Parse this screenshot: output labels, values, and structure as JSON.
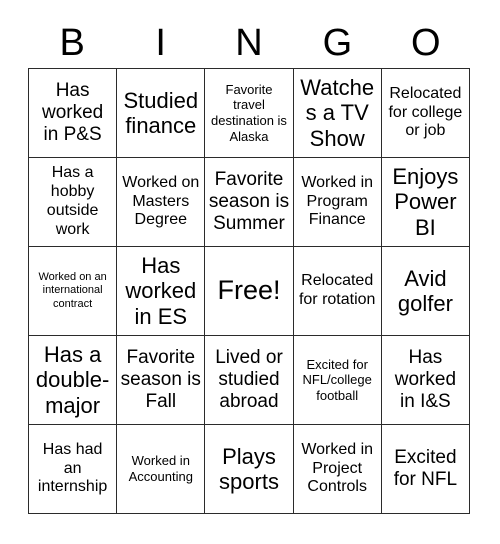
{
  "card": {
    "title": "BINGO",
    "header_letters": [
      "B",
      "I",
      "N",
      "G",
      "O"
    ],
    "border_color": "#2b2b2b",
    "background_color": "#ffffff",
    "text_color": "#000000",
    "rows": 5,
    "columns": 5,
    "cells": [
      {
        "text": "Has worked in P&S",
        "size": "lg",
        "free": false
      },
      {
        "text": "Studied finance",
        "size": "xl",
        "free": false
      },
      {
        "text": "Favorite travel destination is Alaska",
        "size": "sm",
        "free": false
      },
      {
        "text": "Watches a TV Show",
        "size": "xl",
        "free": false
      },
      {
        "text": "Relocated for college or job",
        "size": "md",
        "free": false
      },
      {
        "text": "Has a hobby outside work",
        "size": "md",
        "free": false
      },
      {
        "text": "Worked on Masters Degree",
        "size": "md",
        "free": false
      },
      {
        "text": "Favorite season is Summer",
        "size": "lg",
        "free": false
      },
      {
        "text": "Worked in Program Finance",
        "size": "md",
        "free": false
      },
      {
        "text": "Enjoys Power BI",
        "size": "xl",
        "free": false
      },
      {
        "text": "Worked on an international contract",
        "size": "xs",
        "free": false
      },
      {
        "text": "Has worked in ES",
        "size": "xl",
        "free": false
      },
      {
        "text": "Free!",
        "size": "free",
        "free": true
      },
      {
        "text": "Relocated for rotation",
        "size": "md",
        "free": false
      },
      {
        "text": "Avid golfer",
        "size": "xl",
        "free": false
      },
      {
        "text": "Has a double-major",
        "size": "xl",
        "free": false
      },
      {
        "text": "Favorite season is Fall",
        "size": "lg",
        "free": false
      },
      {
        "text": "Lived or studied abroad",
        "size": "lg",
        "free": false
      },
      {
        "text": "Excited for NFL/college football",
        "size": "sm",
        "free": false
      },
      {
        "text": "Has worked in I&S",
        "size": "lg",
        "free": false
      },
      {
        "text": "Has had an internship",
        "size": "md",
        "free": false
      },
      {
        "text": "Worked in Accounting",
        "size": "sm",
        "free": false
      },
      {
        "text": "Plays sports",
        "size": "xl",
        "free": false
      },
      {
        "text": "Worked in Project Controls",
        "size": "md",
        "free": false
      },
      {
        "text": "Excited for NFL",
        "size": "lg",
        "free": false
      }
    ]
  }
}
